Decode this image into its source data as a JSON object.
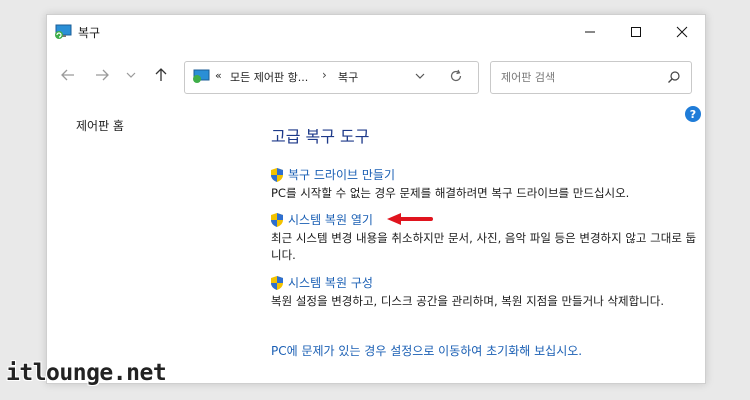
{
  "window": {
    "title": "복구"
  },
  "nav": {
    "address_prefix": "«",
    "address_segment1": "모든 제어판 항...",
    "address_separator": "›",
    "address_segment2": "복구",
    "search_placeholder": "제어판 검색"
  },
  "sidebar": {
    "home_label": "제어판 홈"
  },
  "main": {
    "title": "고급 복구 도구",
    "tasks": [
      {
        "link": "복구 드라이브 만들기",
        "description": "PC를 시작할 수 없는 경우 문제를 해결하려면 복구 드라이브를 만드십시오."
      },
      {
        "link": "시스템 복원 열기",
        "description": "최근 시스템 변경 내용을 취소하지만 문서, 사진, 음악 파일 등은 변경하지 않고 그대로 둡니다."
      },
      {
        "link": "시스템 복원 구성",
        "description": "복원 설정을 변경하고, 디스크 공간을 관리하며, 복원 지점을 만들거나 삭제합니다."
      }
    ],
    "bottom_link": "PC에 문제가 있는 경우 설정으로 이동하여 초기화해 보십시오."
  },
  "help_glyph": "?",
  "watermark": "itlounge.net",
  "colors": {
    "link": "#1a5fb4",
    "title": "#1e3a8a",
    "annotation_arrow": "#e0141e"
  }
}
